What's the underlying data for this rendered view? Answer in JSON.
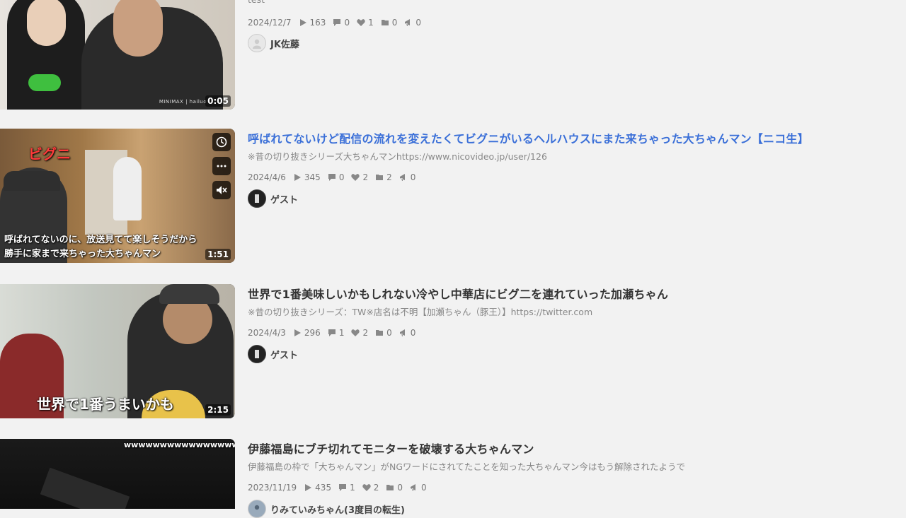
{
  "videos": [
    {
      "title": "",
      "description": "test",
      "date": "2024/12/7",
      "views": "163",
      "comments": "0",
      "likes": "1",
      "mylists": "0",
      "ads": "0",
      "owner": "JK佐藤",
      "duration": "0:05",
      "watermark": "MINIMAX | hailuo"
    },
    {
      "title": "呼ばれてないけど配信の流れを変えたくてビグニがいるヘルハウスにまた来ちゃった大ちゃんマン【ニコ生】",
      "description": "※昔の切り抜きシリーズ大ちゃんマンhttps://www.nicovideo.jp/user/126",
      "date": "2024/4/6",
      "views": "345",
      "comments": "0",
      "likes": "2",
      "mylists": "2",
      "ads": "0",
      "owner": "ゲスト",
      "duration": "1:51",
      "overlay_top": "ビグニ",
      "overlay_line1": "呼ばれてないのに、放送見てて楽しそうだから",
      "overlay_line2": "勝手に家まで来ちゃった大ちゃんマン"
    },
    {
      "title": "世界で1番美味しいかもしれない冷やし中華店にビグ二を連れていった加瀬ちゃん",
      "description": "※昔の切り抜きシリーズ：TW※店名は不明【加瀬ちゃん（豚王）】https://twitter.com",
      "date": "2024/4/3",
      "views": "296",
      "comments": "1",
      "likes": "2",
      "mylists": "0",
      "ads": "0",
      "owner": "ゲスト",
      "duration": "2:15",
      "overlay_main": "世界で1番うまいかも"
    },
    {
      "title": "伊藤福島にブチ切れてモニターを破壊する大ちゃんマン",
      "description": "伊藤福島の枠で「大ちゃんマン」がNGワードにされてたことを知った大ちゃんマン今はもう解除されたようで",
      "date": "2023/11/19",
      "views": "435",
      "comments": "1",
      "likes": "2",
      "mylists": "0",
      "ads": "0",
      "owner": "りみていみちゃん(3度目の転生)",
      "overlay_top": "wwwwwwwwwwwwwwww"
    }
  ],
  "colors": {
    "link": "#3a6fd8",
    "background": "#f2f2f2"
  }
}
